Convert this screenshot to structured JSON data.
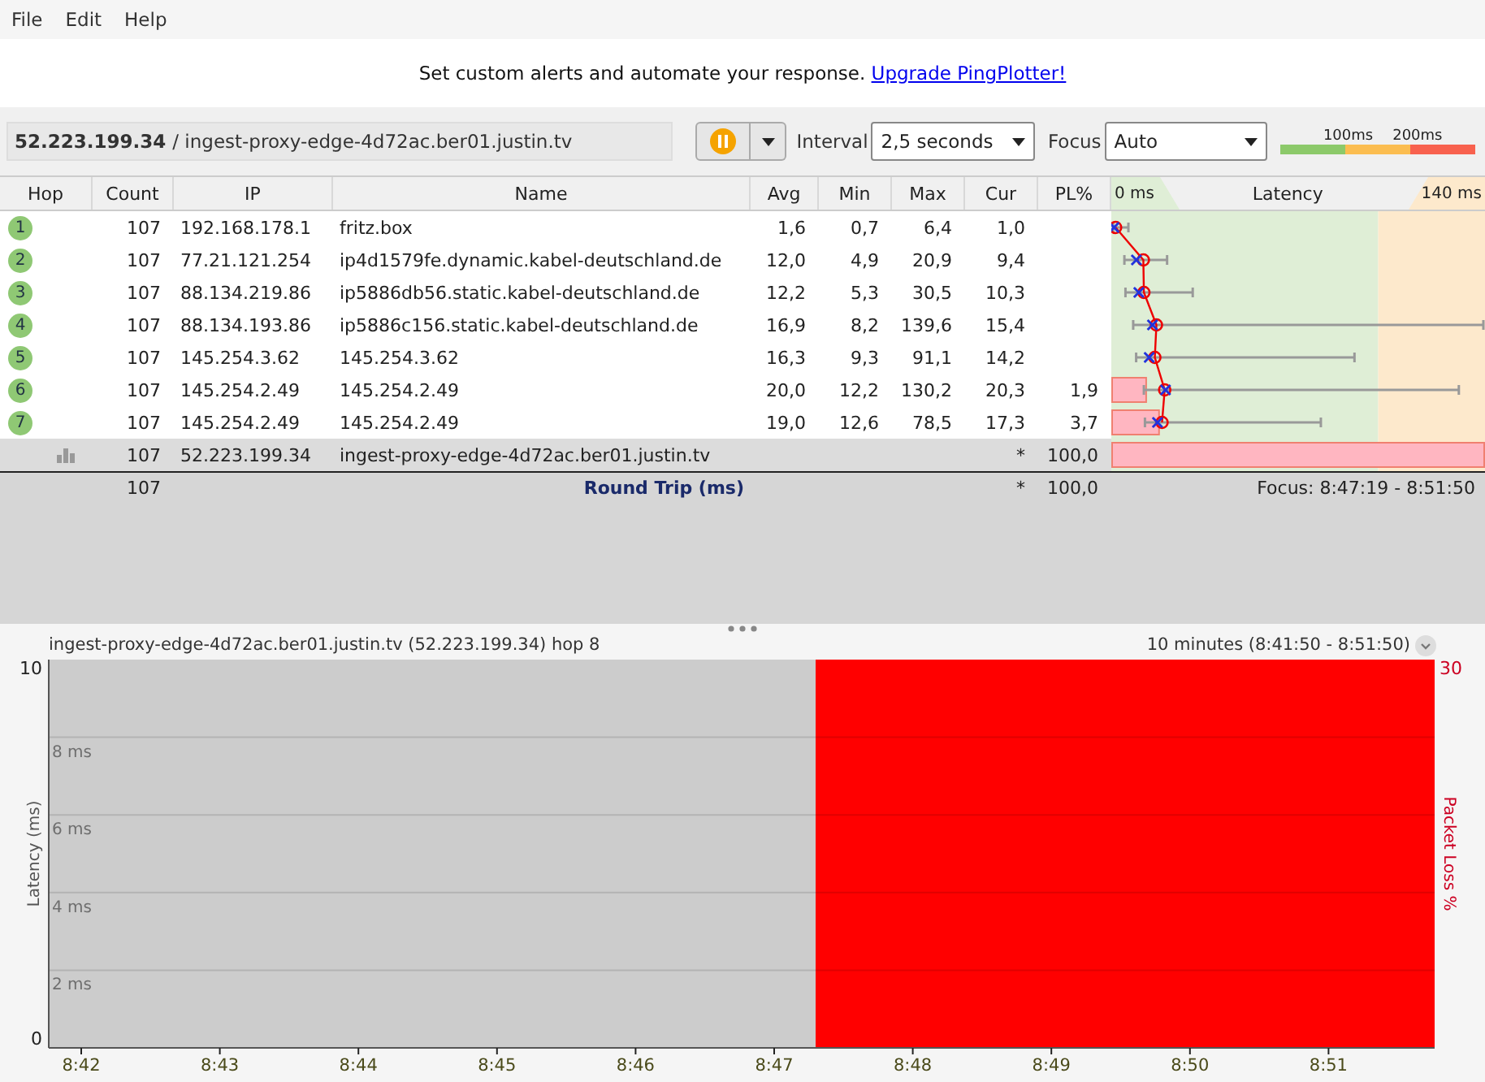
{
  "menu": [
    "File",
    "Edit",
    "Help"
  ],
  "banner": {
    "text": "Set custom alerts and automate your response.",
    "link": "Upgrade PingPlotter!"
  },
  "toolbar": {
    "target_ip": "52.223.199.34",
    "target_path": "/ ingest-proxy-edge-4d72ac.ber01.justin.tv",
    "interval_label": "Interval",
    "interval": "2,5 seconds",
    "focus_label": "Focus",
    "focus": "Auto",
    "legend": [
      "100ms",
      "200ms"
    ]
  },
  "table": {
    "columns": [
      "Hop",
      "Count",
      "IP",
      "Name",
      "Avg",
      "Min",
      "Max",
      "Cur",
      "PL%"
    ],
    "latency_header": {
      "left": "0 ms",
      "title": "Latency",
      "right": "140 ms"
    },
    "rows": [
      {
        "hop": "1",
        "count": "107",
        "ip": "192.168.178.1",
        "name": "fritz.box",
        "avg": "1,6",
        "min": "0,7",
        "max": "6,4",
        "cur": "1,0",
        "selected": false
      },
      {
        "hop": "2",
        "count": "107",
        "ip": "77.21.121.254",
        "name": "ip4d1579fe.dynamic.kabel-deutschland.de",
        "avg": "12,0",
        "min": "4,9",
        "max": "20,9",
        "cur": "9,4",
        "selected": false
      },
      {
        "hop": "3",
        "count": "107",
        "ip": "88.134.219.86",
        "name": "ip5886db56.static.kabel-deutschland.de",
        "avg": "12,2",
        "min": "5,3",
        "max": "30,5",
        "cur": "10,3",
        "selected": false
      },
      {
        "hop": "4",
        "count": "107",
        "ip": "88.134.193.86",
        "name": "ip5886c156.static.kabel-deutschland.de",
        "avg": "16,9",
        "min": "8,2",
        "max": "139,6",
        "cur": "15,4",
        "selected": false
      },
      {
        "hop": "5",
        "count": "107",
        "ip": "145.254.3.62",
        "name": "145.254.3.62",
        "avg": "16,3",
        "min": "9,3",
        "max": "91,1",
        "cur": "14,2",
        "selected": false
      },
      {
        "hop": "6",
        "count": "107",
        "ip": "145.254.2.49",
        "name": "145.254.2.49",
        "avg": "20,0",
        "min": "12,2",
        "max": "130,2",
        "cur": "20,3",
        "pl": "1,9",
        "selected": false
      },
      {
        "hop": "7",
        "count": "107",
        "ip": "145.254.2.49",
        "name": "145.254.2.49",
        "avg": "19,0",
        "min": "12,6",
        "max": "78,5",
        "cur": "17,3",
        "pl": "3,7",
        "selected": false
      },
      {
        "count": "107",
        "ip": "52.223.199.34",
        "name": "ingest-proxy-edge-4d72ac.ber01.justin.tv",
        "cur": "*",
        "pl": "100,0",
        "selected": true
      }
    ],
    "summary": {
      "count": "107",
      "label": "Round Trip (ms)",
      "cur": "*",
      "pl": "100,0",
      "focus": "Focus: 8:47:19 - 8:51:50"
    }
  },
  "graph_panel": {
    "title": "ingest-proxy-edge-4d72ac.ber01.justin.tv (52.223.199.34) hop 8",
    "time_range": "10 minutes (8:41:50 - 8:51:50)",
    "graph": {
      "y_axis_title": "Latency (ms)",
      "y_top_label": "10",
      "y_bottom_label": "0",
      "gridline_labels": [
        "8 ms",
        "6 ms",
        "4 ms",
        "2 ms"
      ],
      "time_labels": [
        "8:42",
        "8:43",
        "8:44",
        "8:45",
        "8:46",
        "8:47",
        "8:48",
        "8:49",
        "8:50",
        "8:51"
      ],
      "right_axis_title": "Packet Loss %",
      "right_top_label": "30"
    }
  }
}
